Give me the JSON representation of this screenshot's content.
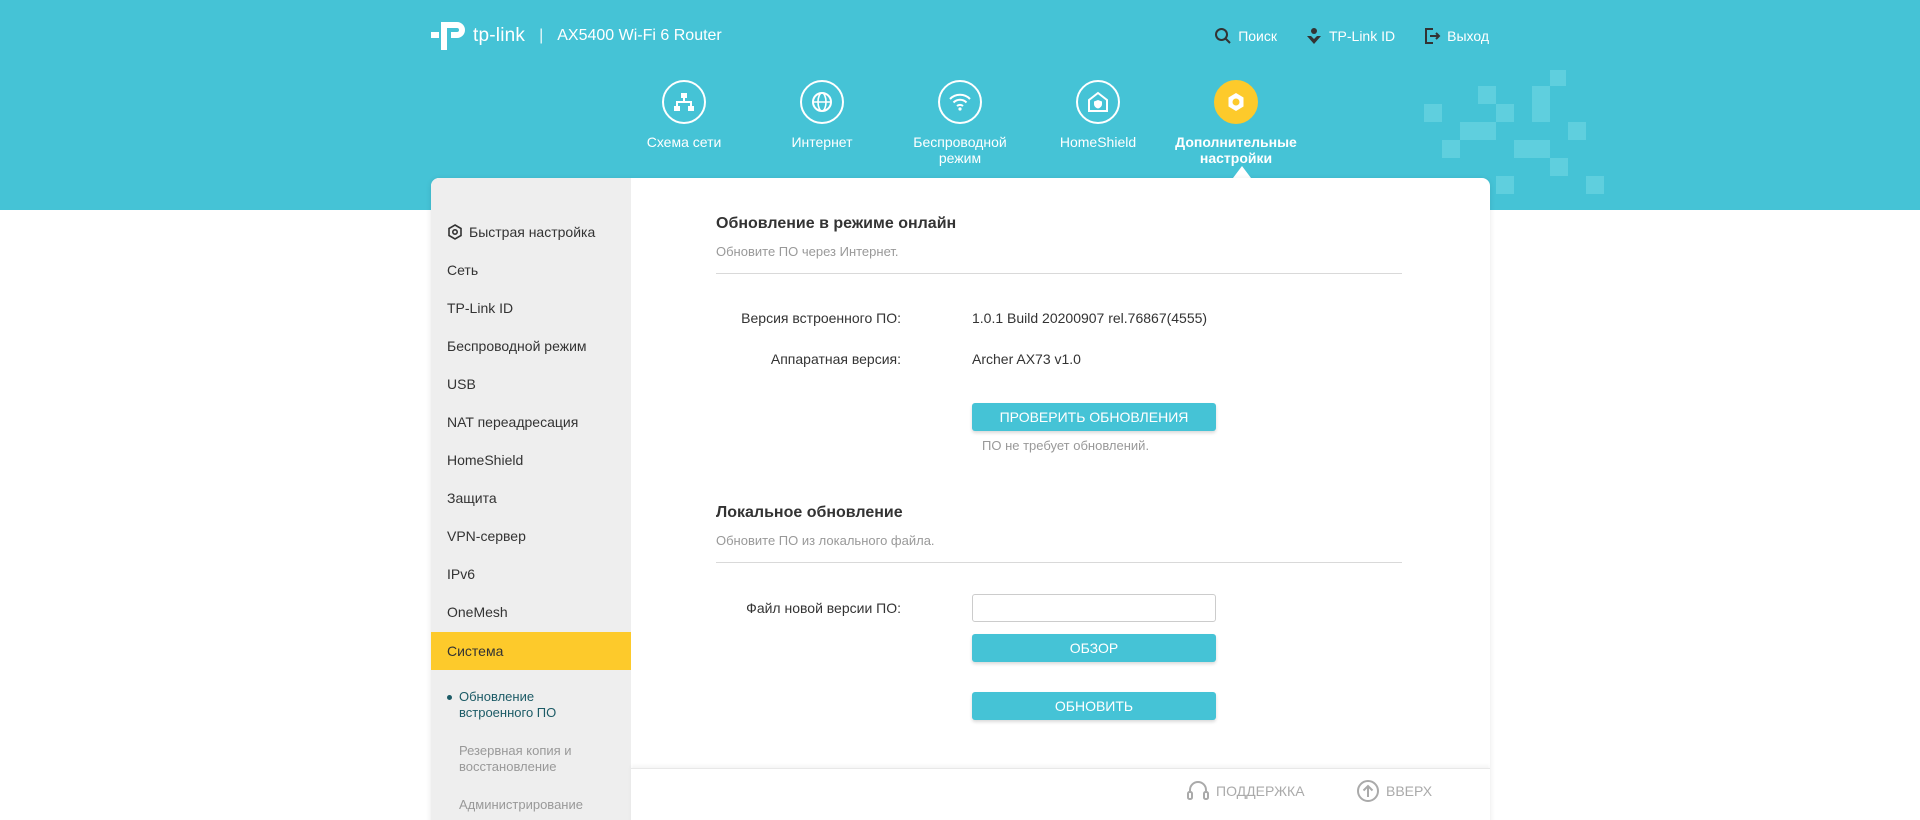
{
  "header": {
    "logo_text": "tp-link",
    "separator": "|",
    "model": "AX5400 Wi-Fi 6 Router",
    "actions": [
      {
        "label": "Поиск",
        "icon": "search-icon"
      },
      {
        "label": "TP-Link ID",
        "icon": "tplink-id-icon"
      },
      {
        "label": "Выход",
        "icon": "logout-icon"
      }
    ]
  },
  "mainnav": [
    {
      "label": "Схема сети",
      "icon": "network-map-icon"
    },
    {
      "label": "Интернет",
      "icon": "globe-icon"
    },
    {
      "label_line1": "Беспроводной",
      "label_line2": "режим",
      "icon": "wifi-icon"
    },
    {
      "label": "HomeShield",
      "icon": "homeshield-icon"
    },
    {
      "label_line1": "Дополнительные",
      "label_line2": "настройки",
      "icon": "gear-icon",
      "active": true
    }
  ],
  "sidebar": {
    "items": [
      {
        "label": "Быстрая настройка",
        "icon": "quick-setup-icon"
      },
      {
        "label": "Сеть"
      },
      {
        "label": "TP-Link ID"
      },
      {
        "label": "Беспроводной режим"
      },
      {
        "label": "USB"
      },
      {
        "label": "NAT переадресация"
      },
      {
        "label": "HomeShield"
      },
      {
        "label": "Защита"
      },
      {
        "label": "VPN-сервер"
      },
      {
        "label": "IPv6"
      },
      {
        "label": "OneMesh"
      },
      {
        "label": "Система",
        "active": true
      }
    ],
    "subitems": [
      {
        "line1": "Обновление",
        "line2": "встроенного ПО",
        "active": true
      },
      {
        "line1": "Резервная копия и",
        "line2": "восстановление"
      },
      {
        "line1": "Администрирование"
      }
    ]
  },
  "online": {
    "title": "Обновление в режиме онлайн",
    "desc": "Обновите ПО через Интернет.",
    "fw_label": "Версия встроенного ПО:",
    "fw_value": "1.0.1 Build 20200907 rel.76867(4555)",
    "hw_label": "Аппаратная версия:",
    "hw_value": "Archer AX73 v1.0",
    "check_button": "ПРОВЕРИТЬ ОБНОВЛЕНИЯ",
    "status": "ПО не требует обновлений."
  },
  "local": {
    "title": "Локальное обновление",
    "desc": "Обновите ПО из локального файла.",
    "file_label": "Файл новой версии ПО:",
    "file_value": "",
    "browse_button": "ОБЗОР",
    "update_button": "ОБНОВИТЬ"
  },
  "footer": {
    "support": "ПОДДЕРЖКА",
    "top": "ВВЕРХ"
  },
  "colors": {
    "header_bg": "#45c3d6",
    "accent": "#fdca2b",
    "button": "#45c3d6",
    "sidebar_bg": "#eeeeee"
  }
}
